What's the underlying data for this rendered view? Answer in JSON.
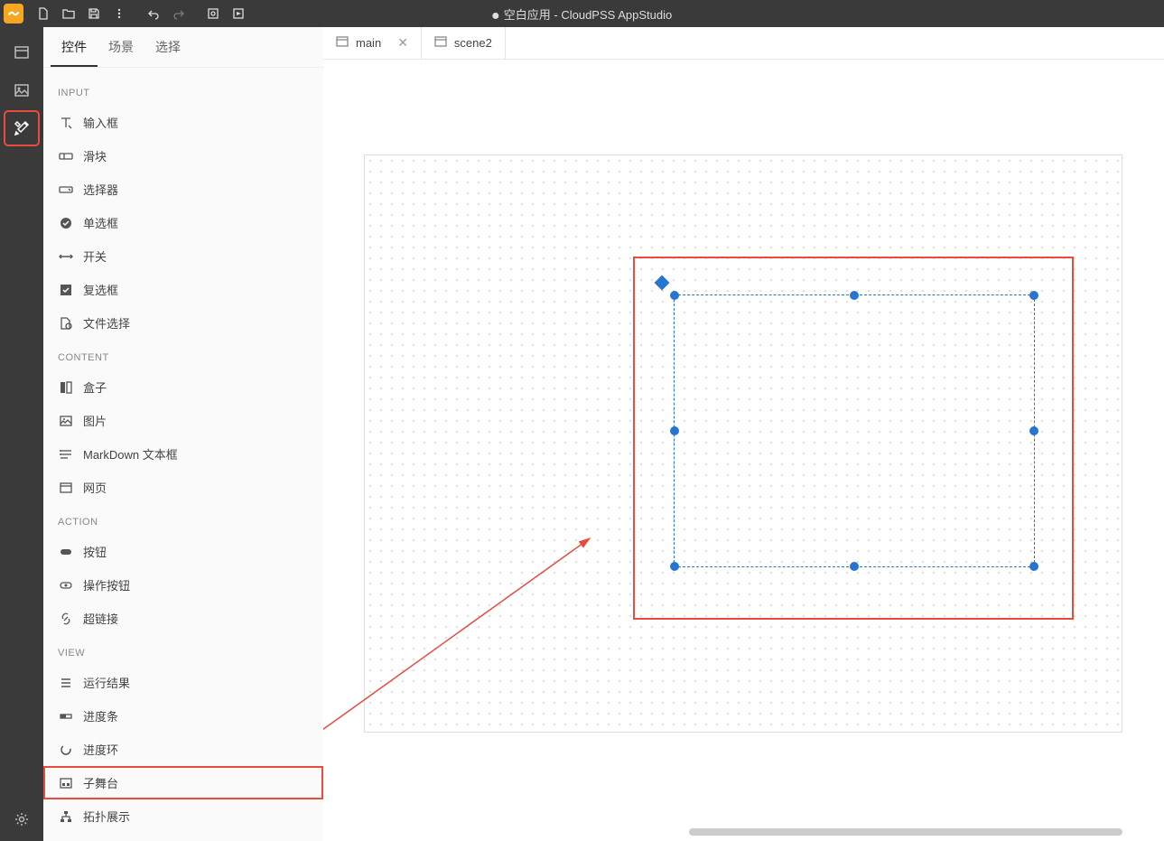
{
  "title": "空白应用 - CloudPSS AppStudio",
  "panel": {
    "tabs": {
      "widgets": "控件",
      "scenes": "场景",
      "select": "选择"
    },
    "sections": {
      "input": {
        "head": "INPUT",
        "items": [
          "输入框",
          "滑块",
          "选择器",
          "单选框",
          "开关",
          "复选框",
          "文件选择"
        ]
      },
      "content": {
        "head": "CONTENT",
        "items": [
          "盒子",
          "图片",
          "MarkDown 文本框",
          "网页"
        ]
      },
      "action": {
        "head": "ACTION",
        "items": [
          "按钮",
          "操作按钮",
          "超链接"
        ]
      },
      "view": {
        "head": "VIEW",
        "items": [
          "运行结果",
          "进度条",
          "进度环",
          "子舞台",
          "拓扑展示"
        ]
      }
    }
  },
  "scenes": {
    "main": "main",
    "scene2": "scene2"
  }
}
